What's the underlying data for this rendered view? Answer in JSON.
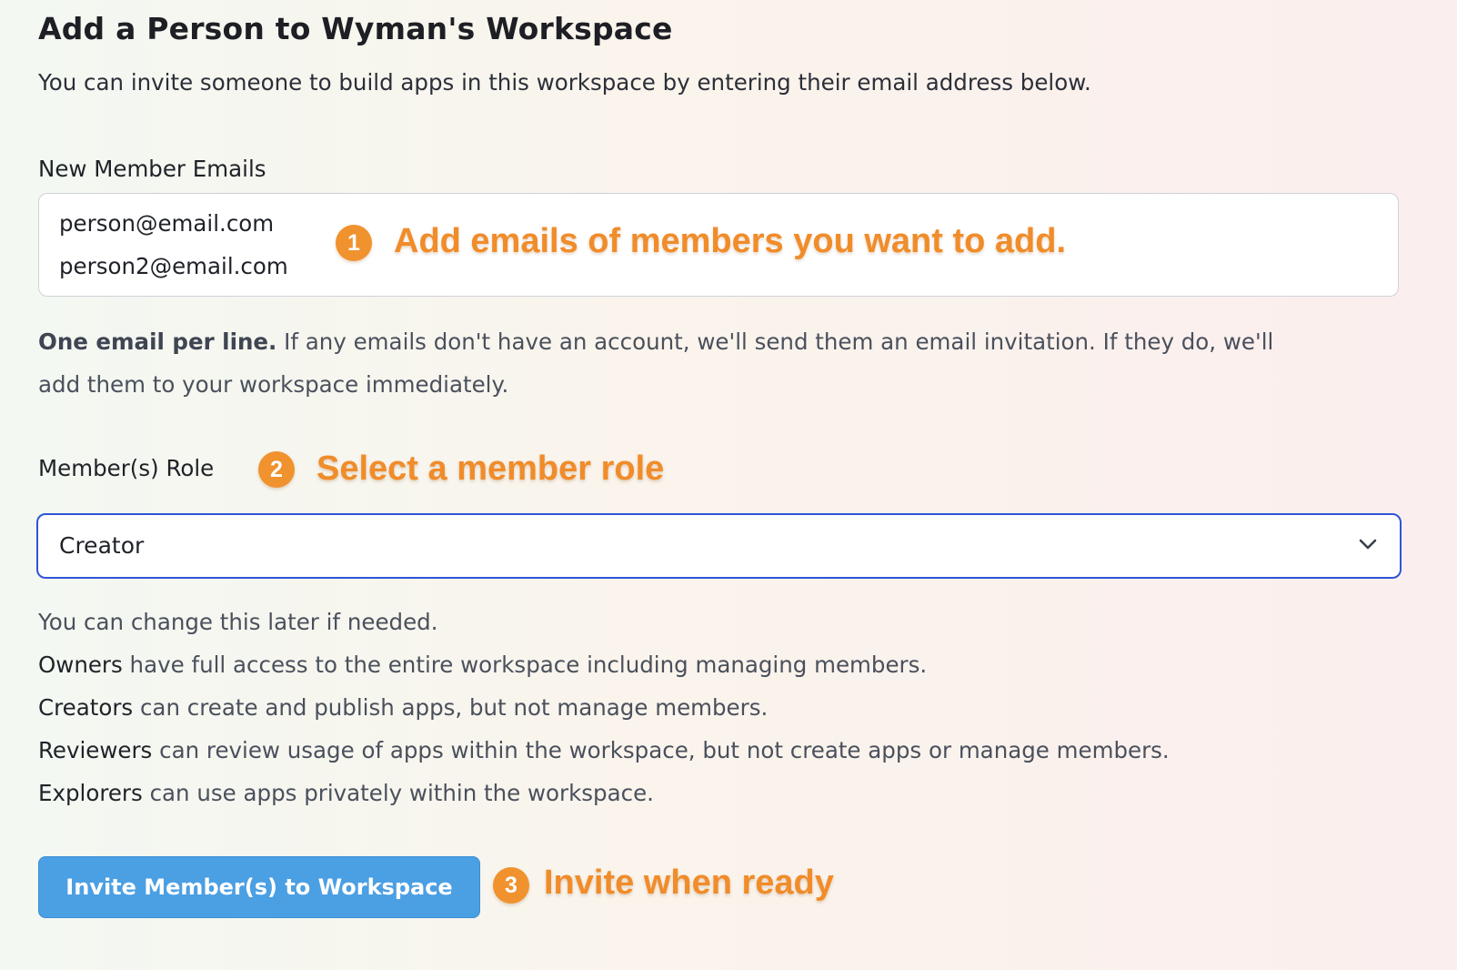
{
  "header": {
    "title": "Add a Person to Wyman's Workspace",
    "intro": "You can invite someone to build apps in this workspace by entering their email address below."
  },
  "emails": {
    "label": "New Member Emails",
    "lines": [
      "person@email.com",
      "person2@email.com"
    ],
    "help_bold": "One email per line.",
    "help_rest_1": " If any emails don't have an account, we'll send them an email invitation. If they do, we'll",
    "help_rest_2": "add them to your workspace immediately."
  },
  "role": {
    "label": "Member(s) Role",
    "selected": "Creator",
    "note": "You can change this later if needed.",
    "descriptions": [
      {
        "name": "Owners",
        "text": " have full access to the entire workspace including managing members."
      },
      {
        "name": "Creators",
        "text": " can create and publish apps, but not manage members."
      },
      {
        "name": "Reviewers",
        "text": " can review usage of apps within the workspace, but not create apps or manage members."
      },
      {
        "name": "Explorers",
        "text": " can use apps privately within the workspace."
      }
    ]
  },
  "button": {
    "label": "Invite Member(s) to Workspace"
  },
  "annotations": [
    {
      "number": "1",
      "text": "Add emails of members you want to add."
    },
    {
      "number": "2",
      "text": "Select a member role"
    },
    {
      "number": "3",
      "text": "Invite when ready"
    }
  ],
  "colors": {
    "annotation": "#f08c2a",
    "button": "#4b9fe3",
    "focus_border": "#2f55d6"
  },
  "icons": {
    "select_chevron": "chevron-down-icon"
  }
}
